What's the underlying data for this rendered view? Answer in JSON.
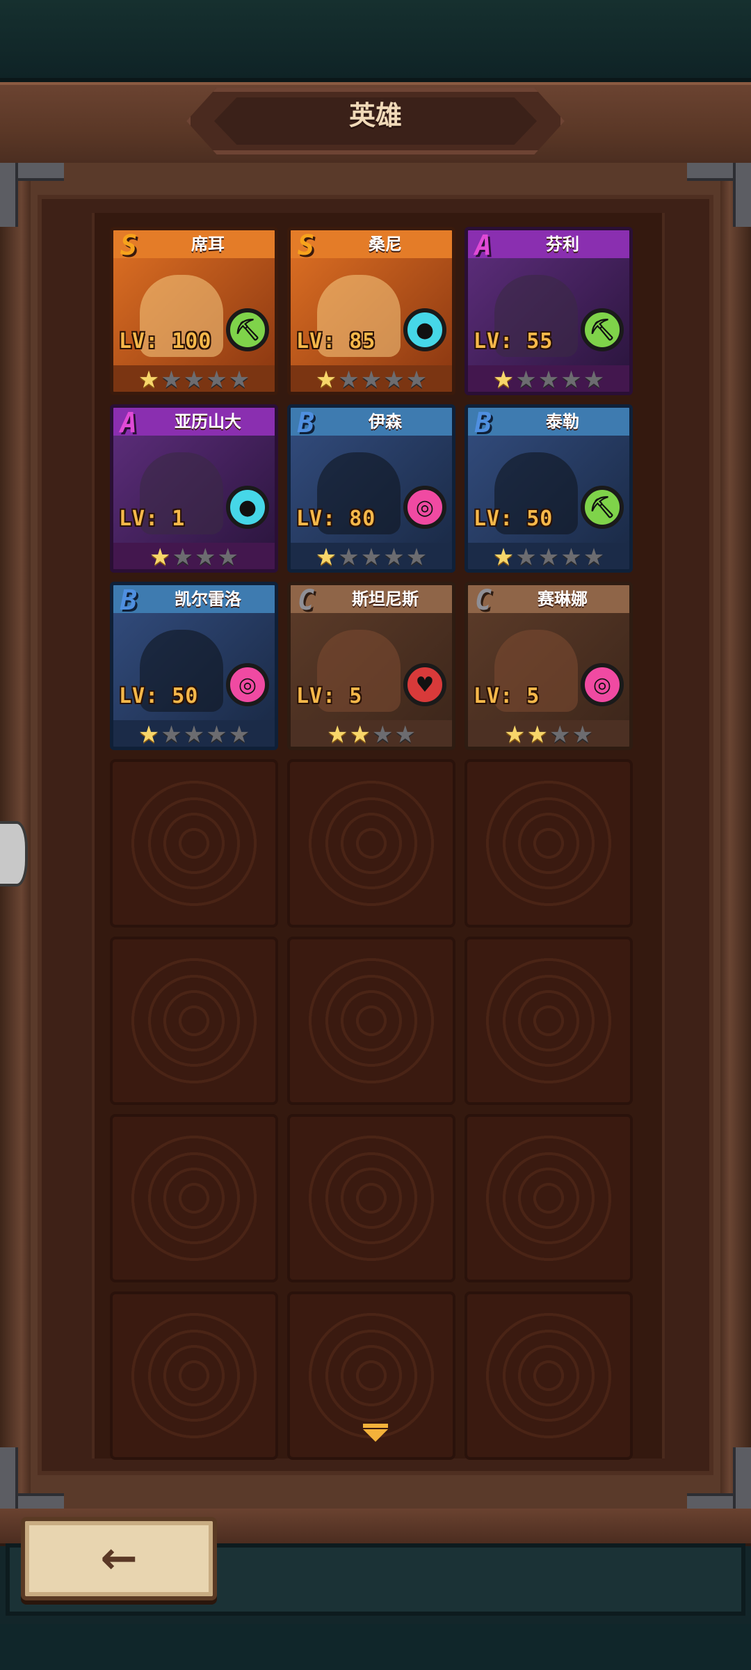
{
  "header": {
    "title": "英雄"
  },
  "heroes": [
    {
      "name": "席耳",
      "grade": "S",
      "level": "LV: 100",
      "stars": 1,
      "max_stars": 5,
      "role_icon": "pickaxe-icon",
      "role_color": "#7fd34a"
    },
    {
      "name": "桑尼",
      "grade": "S",
      "level": "LV: 85",
      "stars": 1,
      "max_stars": 5,
      "role_icon": "water-drop-icon",
      "role_color": "#46d7e8"
    },
    {
      "name": "芬利",
      "grade": "A",
      "level": "LV: 55",
      "stars": 1,
      "max_stars": 5,
      "role_icon": "pickaxe-icon",
      "role_color": "#7fd34a"
    },
    {
      "name": "亚历山大",
      "grade": "A",
      "level": "LV: 1",
      "stars": 1,
      "max_stars": 4,
      "role_icon": "water-drop-icon",
      "role_color": "#46d7e8"
    },
    {
      "name": "伊森",
      "grade": "B",
      "level": "LV: 80",
      "stars": 1,
      "max_stars": 5,
      "role_icon": "target-icon",
      "role_color": "#f04aa2"
    },
    {
      "name": "泰勒",
      "grade": "B",
      "level": "LV: 50",
      "stars": 1,
      "max_stars": 5,
      "role_icon": "pickaxe-icon",
      "role_color": "#7fd34a"
    },
    {
      "name": "凯尔雷洛",
      "grade": "B",
      "level": "LV: 50",
      "stars": 1,
      "max_stars": 5,
      "role_icon": "target-icon",
      "role_color": "#f04aa2"
    },
    {
      "name": "斯坦尼斯",
      "grade": "C",
      "level": "LV: 5",
      "stars": 2,
      "max_stars": 4,
      "role_icon": "heart-icon",
      "role_color": "#d83a3a"
    },
    {
      "name": "赛琳娜",
      "grade": "C",
      "level": "LV: 5",
      "stars": 2,
      "max_stars": 4,
      "role_icon": "target-icon",
      "role_color": "#f04aa2"
    }
  ],
  "empty_slots": 12,
  "footer": {
    "back_icon": "back-arrow-icon",
    "scroll_icon": "chevron-down-icon"
  }
}
